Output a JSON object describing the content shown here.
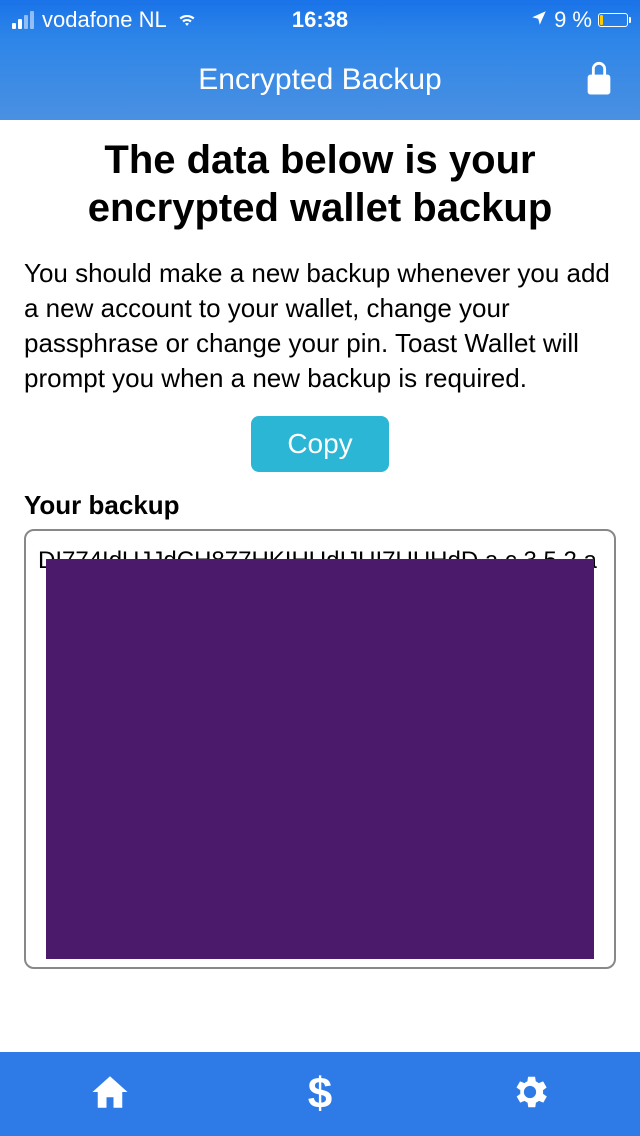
{
  "statusBar": {
    "carrier": "vodafone NL",
    "time": "16:38",
    "batteryText": "9 %"
  },
  "header": {
    "title": "Encrypted Backup"
  },
  "main": {
    "title": "The data below is your encrypted wallet backup",
    "description": "You should make a new backup whenever you add a new account to your wallet, change your passphrase or change your pin. Toast Wallet will prompt you when a new backup is required.",
    "copyLabel": "Copy",
    "backupLabel": "Your backup"
  },
  "nav": {
    "dollar": "$"
  }
}
